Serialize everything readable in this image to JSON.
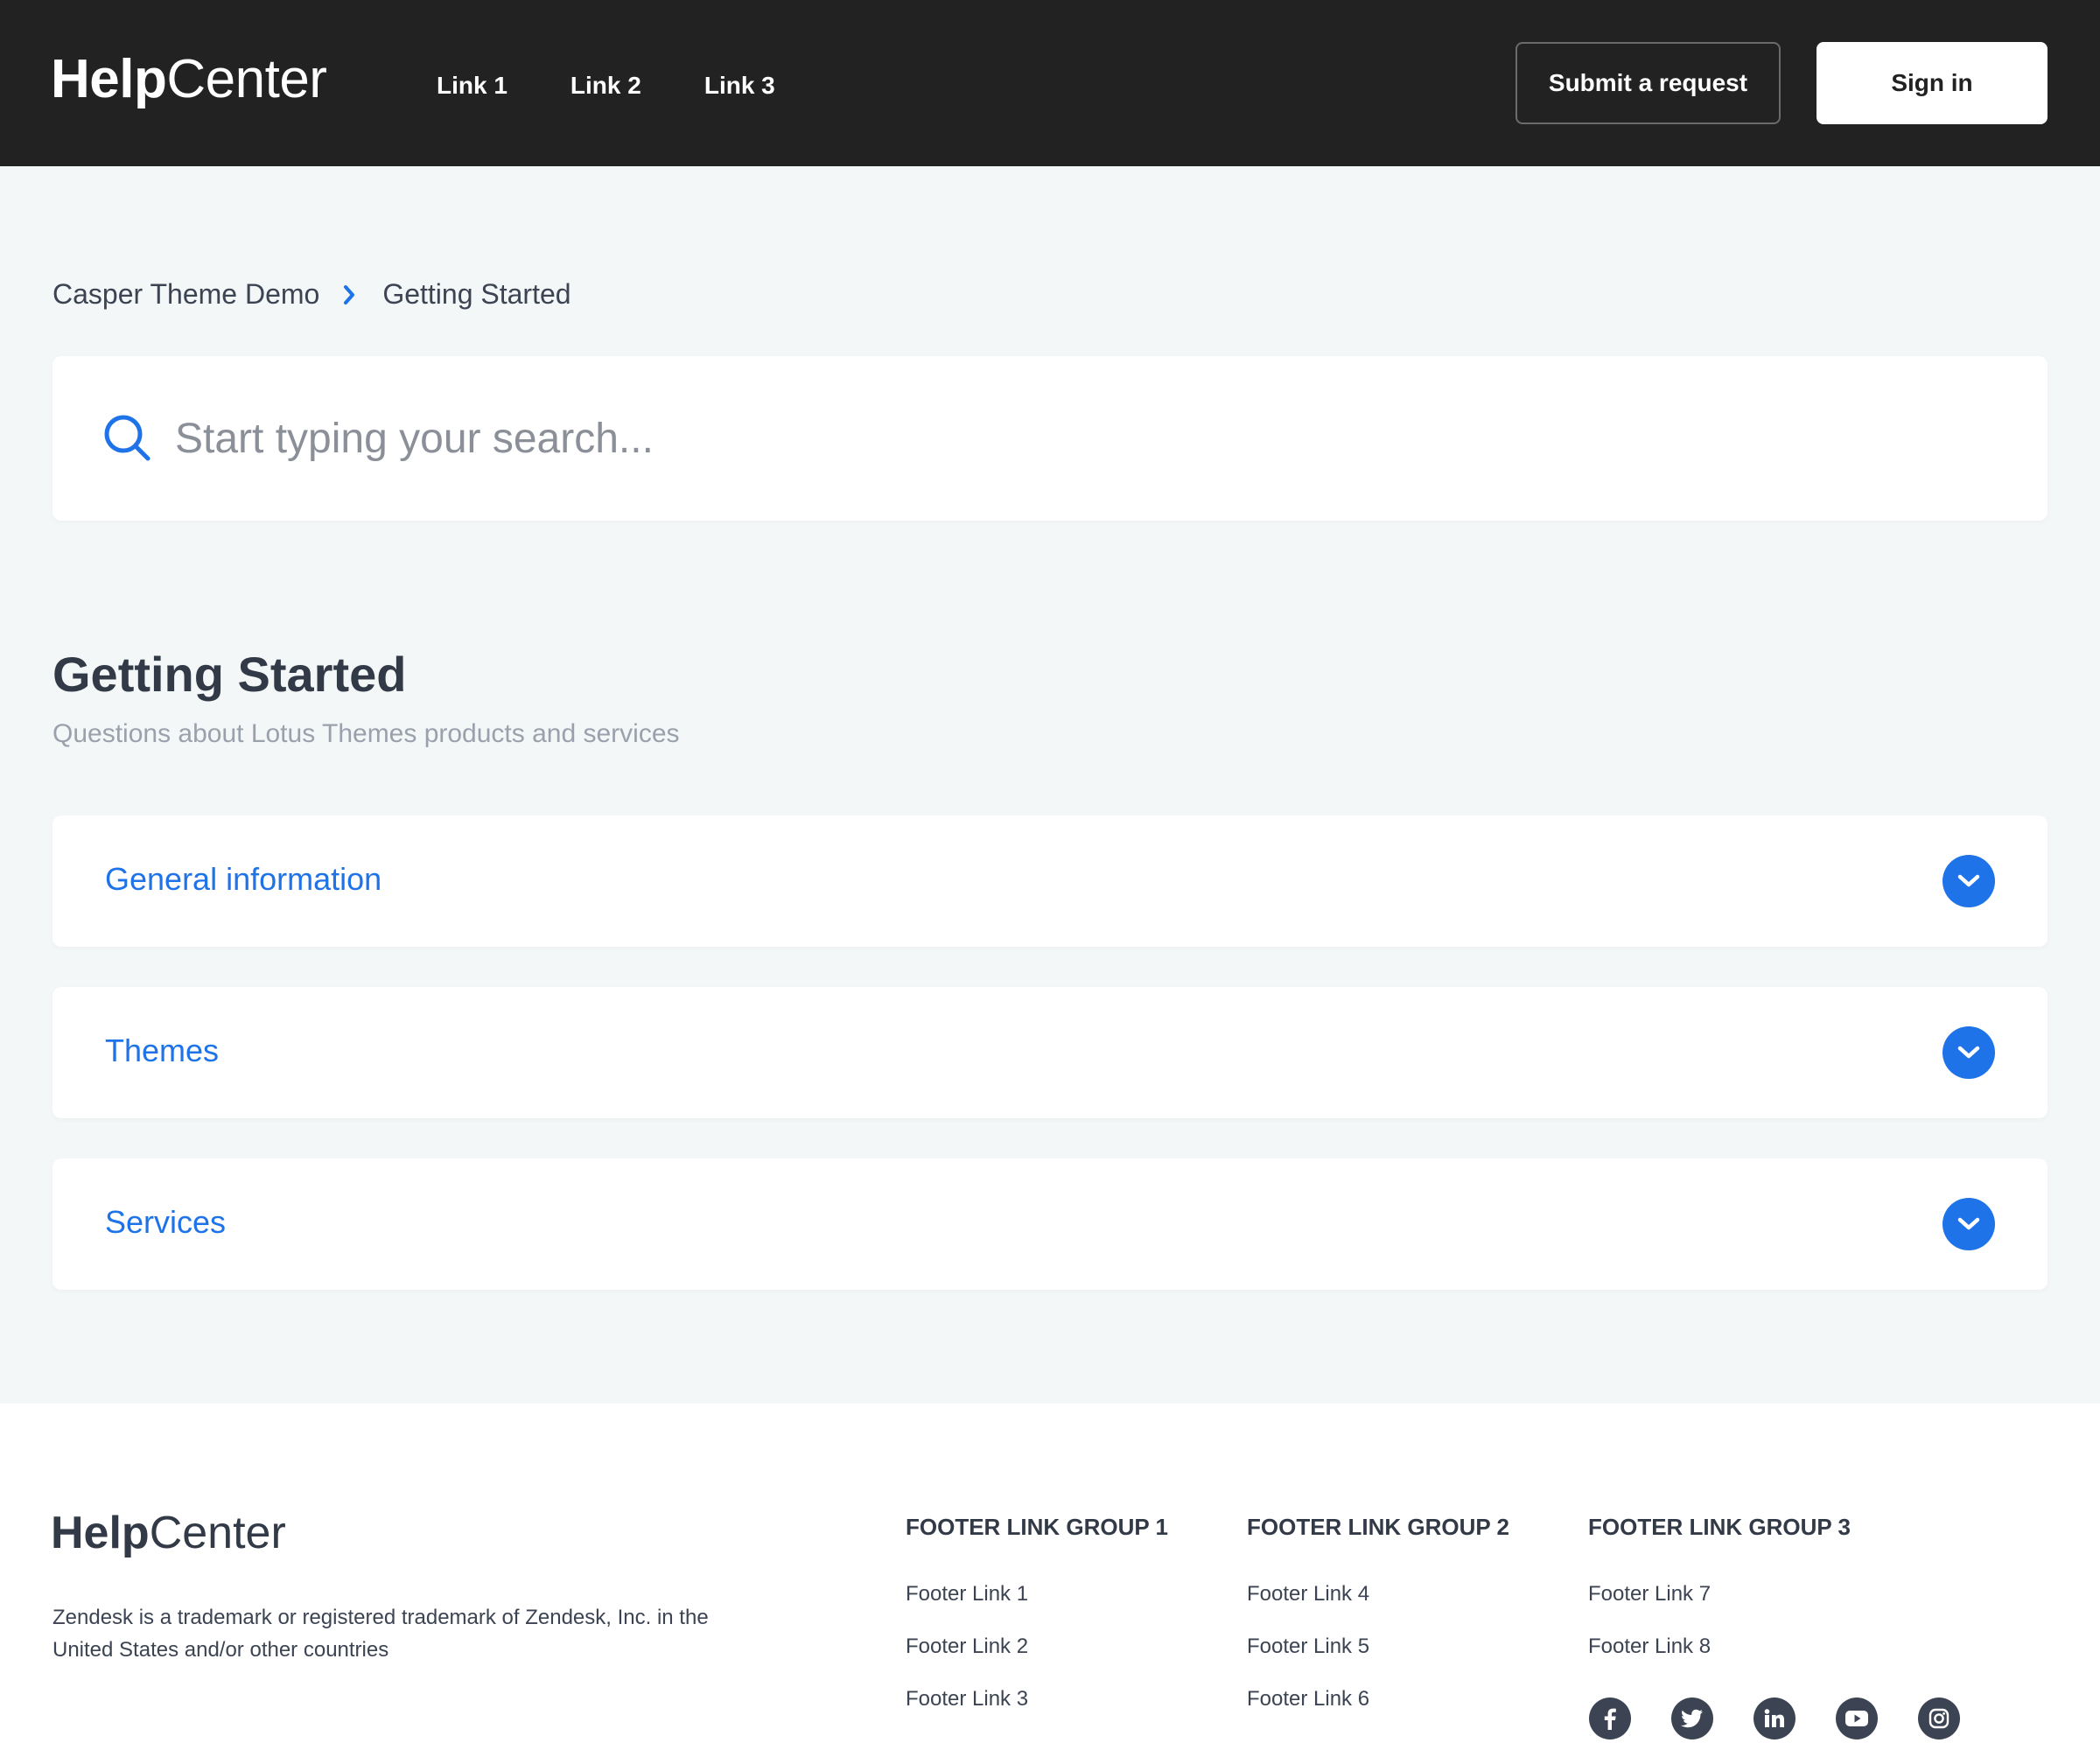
{
  "header": {
    "logo_bold": "Help",
    "logo_regular": "Center",
    "nav": [
      "Link 1",
      "Link 2",
      "Link 3"
    ],
    "submit_label": "Submit a request",
    "signin_label": "Sign in"
  },
  "breadcrumb": {
    "items": [
      "Casper Theme Demo",
      "Getting Started"
    ]
  },
  "search": {
    "placeholder": "Start typing your search..."
  },
  "section": {
    "title": "Getting Started",
    "subtitle": "Questions about Lotus Themes products and services"
  },
  "accordion": [
    "General information",
    "Themes",
    "Services"
  ],
  "footer": {
    "logo_bold": "Help",
    "logo_regular": "Center",
    "legal": "Zendesk is a trademark or registered trademark of Zendesk, Inc. in the United States and/or other countries",
    "groups": [
      {
        "title": "FOOTER LINK GROUP 1",
        "links": [
          "Footer Link 1",
          "Footer Link 2",
          "Footer Link 3"
        ]
      },
      {
        "title": "FOOTER LINK GROUP 2",
        "links": [
          "Footer Link 4",
          "Footer Link 5",
          "Footer Link 6"
        ]
      },
      {
        "title": "FOOTER LINK GROUP 3",
        "links": [
          "Footer Link 7",
          "Footer Link 8"
        ]
      }
    ],
    "socials": [
      "facebook-icon",
      "twitter-icon",
      "linkedin-icon",
      "youtube-icon",
      "instagram-icon"
    ]
  },
  "colors": {
    "accent": "#1f73e8",
    "header_bg": "#222222",
    "page_bg": "#f3f7f7"
  }
}
